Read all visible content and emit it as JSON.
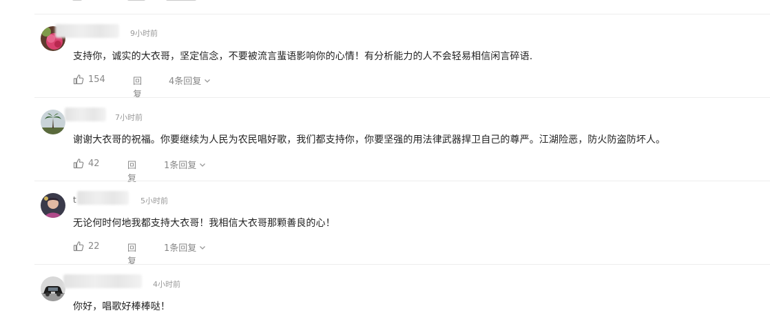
{
  "comments": [
    {
      "username_initial": "",
      "time": "9小时前",
      "content": "支持你，诚实的大衣哥，坚定信念，不要被流言蜚语影响你的心情！有分析能力的人不会轻易相信闲言碎语.",
      "likes": "154",
      "reply_label": "回复",
      "replies_label": "4条回复",
      "avatar_icon": "avatar-pink-flower"
    },
    {
      "username_initial": "",
      "time": "7小时前",
      "content": "谢谢大衣哥的祝福。你要继续为人民为农民唱好歌，我们都支持你，你要坚强的用法律武器捍卫自己的尊严。江湖险恶，防火防盗防坏人。",
      "likes": "42",
      "reply_label": "回复",
      "replies_label": "1条回复",
      "avatar_icon": "avatar-palm-tree"
    },
    {
      "username_initial": "t",
      "time": "5小时前",
      "content": "无论何时何地我都支持大衣哥！我相信大衣哥那颗善良的心！",
      "likes": "22",
      "reply_label": "回复",
      "replies_label": "1条回复",
      "avatar_icon": "avatar-child-photo"
    },
    {
      "username_initial": "",
      "time": "4小时前",
      "content": "你好，唱歌好棒棒哒！",
      "avatar_icon": "avatar-car"
    }
  ],
  "icons": {
    "like": "thumbs-up-icon",
    "expand": "chevron-down-icon"
  },
  "colors": {
    "text": "#222222",
    "meta": "#999999",
    "action": "#888888",
    "divider": "#ededed"
  }
}
